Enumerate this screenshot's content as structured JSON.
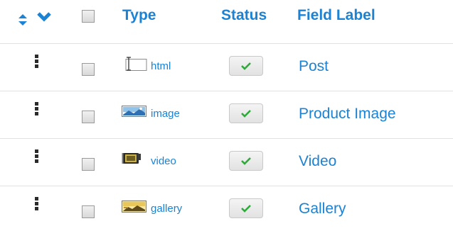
{
  "header": {
    "type_label": "Type",
    "status_label": "Status",
    "field_label": "Field Label"
  },
  "rows": [
    {
      "type": "html",
      "type_icon": "text-field-icon",
      "status": "enabled",
      "label": "Post"
    },
    {
      "type": "image",
      "type_icon": "image-icon",
      "status": "enabled",
      "label": "Product Image"
    },
    {
      "type": "video",
      "type_icon": "video-icon",
      "status": "enabled",
      "label": "Video"
    },
    {
      "type": "gallery",
      "type_icon": "gallery-icon",
      "status": "enabled",
      "label": "Gallery"
    }
  ],
  "colors": {
    "link": "#1b82d4",
    "check": "#2eaa3a",
    "divider": "#e1e1e1"
  }
}
